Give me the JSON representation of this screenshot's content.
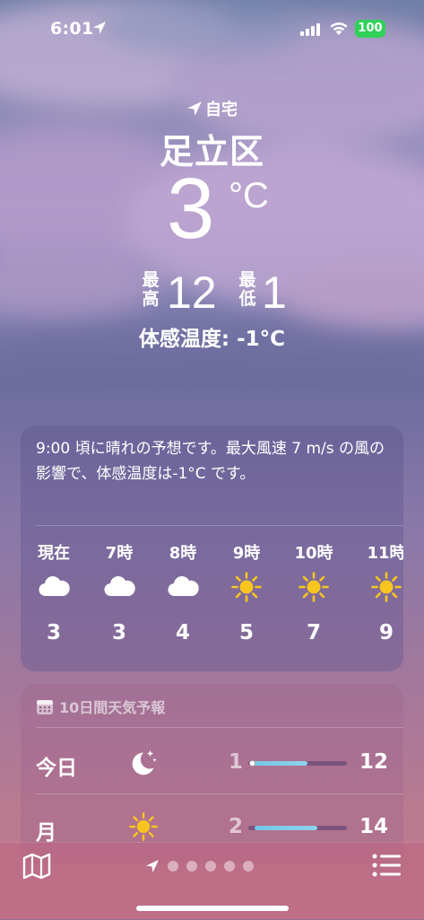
{
  "status_bar": {
    "time": "6:01",
    "battery": "100"
  },
  "header": {
    "location_label": "自宅",
    "city": "足立区",
    "temperature": "3",
    "temperature_unit": "°C",
    "high_label": "最高",
    "high": "12",
    "low_label": "最低",
    "low": "1",
    "feels_like": "体感温度: -1°C"
  },
  "hourly": {
    "summary": "9:00 頃に晴れの予想です。最大風速 7 m/s の風の影響で、体感温度は-1°C です。",
    "items": [
      {
        "label": "現在",
        "icon": "cloud-icon",
        "temp": "3"
      },
      {
        "label": "7時",
        "icon": "cloud-icon",
        "temp": "3"
      },
      {
        "label": "8時",
        "icon": "cloud-icon",
        "temp": "4"
      },
      {
        "label": "9時",
        "icon": "sun-icon",
        "temp": "5"
      },
      {
        "label": "10時",
        "icon": "sun-icon",
        "temp": "7"
      },
      {
        "label": "11時",
        "icon": "sun-icon",
        "temp": "9"
      }
    ]
  },
  "ten_day": {
    "title": "10日間天気予報",
    "days": [
      {
        "name": "今日",
        "icon": "moon-stars-icon",
        "low": "1",
        "high": "12",
        "range_start": 0.04,
        "range_end": 0.6,
        "current_marker": 0.04
      },
      {
        "name": "月",
        "icon": "sun-icon",
        "low": "2",
        "high": "14",
        "range_start": 0.06,
        "range_end": 0.7
      }
    ]
  },
  "bottom_bar": {
    "page_count": 6,
    "active_page": 0
  },
  "colors": {
    "sun": "#f7c51e",
    "battery": "#30d158",
    "temp_bar": "#73c7e8"
  }
}
